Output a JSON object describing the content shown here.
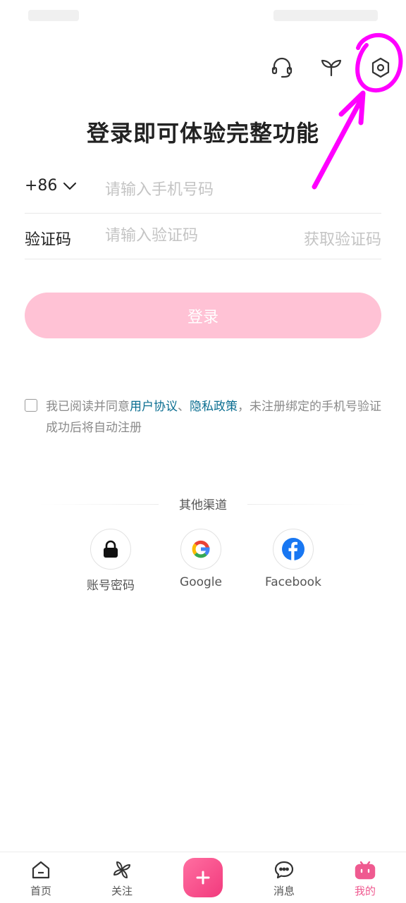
{
  "top_icons": [
    "headset-icon",
    "sprout-icon",
    "settings-icon"
  ],
  "title": "登录即可体验完整功能",
  "phone": {
    "country_code": "+86",
    "placeholder": "请输入手机号码"
  },
  "code": {
    "label": "验证码",
    "placeholder": "请输入验证码",
    "get_code": "获取验证码"
  },
  "login_button": "登录",
  "agreement": {
    "prefix": "我已阅读并同意",
    "user_agreement": "用户协议",
    "separator": "、",
    "privacy_policy": "隐私政策",
    "suffix": "，未注册绑定的手机号验证成功后将自动注册"
  },
  "other_channels": {
    "label": "其他渠道",
    "items": [
      {
        "name": "账号密码",
        "icon": "lock-icon"
      },
      {
        "name": "Google",
        "icon": "google-icon"
      },
      {
        "name": "Facebook",
        "icon": "facebook-icon"
      }
    ]
  },
  "tabbar": [
    {
      "label": "首页",
      "icon": "home-icon"
    },
    {
      "label": "关注",
      "icon": "pinwheel-icon"
    },
    {
      "label": "",
      "icon": "plus-icon"
    },
    {
      "label": "消息",
      "icon": "chat-icon"
    },
    {
      "label": "我的",
      "icon": "tv-icon",
      "active": true
    }
  ],
  "colors": {
    "accent": "#ef5a90",
    "login_button": "#ffc2d5",
    "link": "#0b6e91",
    "annotation": "#ff00ff"
  }
}
